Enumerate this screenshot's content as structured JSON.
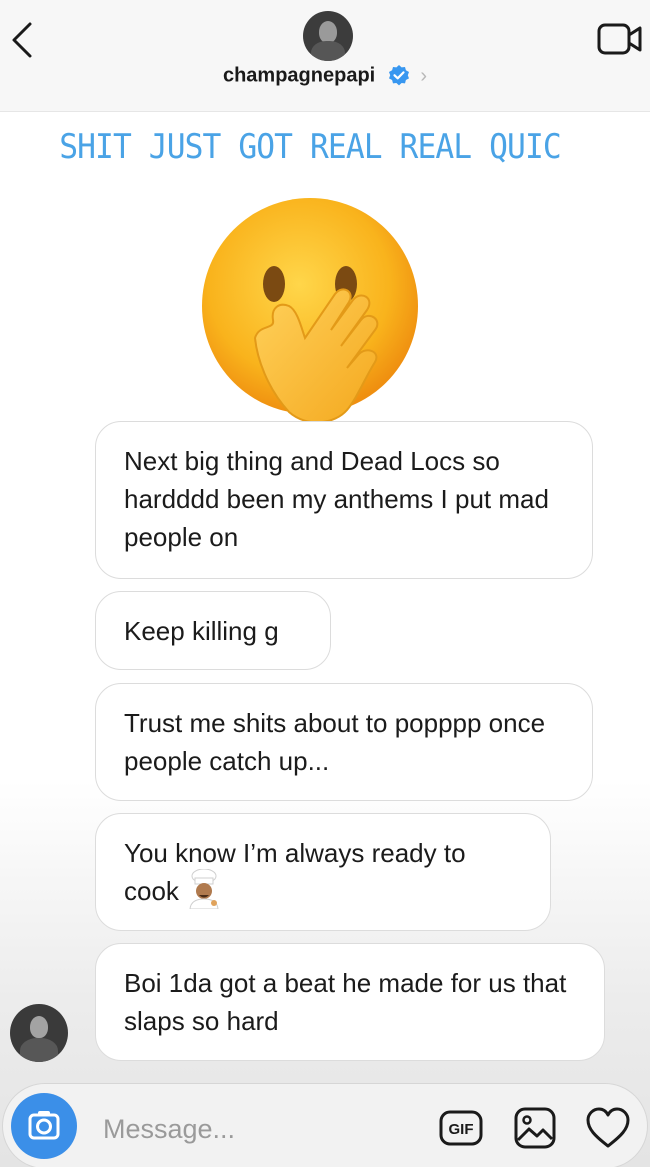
{
  "header": {
    "username": "champagnepapi",
    "verified": true,
    "chevron": "›"
  },
  "story": {
    "caption": "SHIT JUST GOT REAL REAL QUIC",
    "emoji": "face-with-hand-over-mouth"
  },
  "messages": [
    {
      "text": "Next big thing and Dead Locs so hardddd been my anthems I put mad people on"
    },
    {
      "text": "Keep killing g"
    },
    {
      "text": "Trust me shits about to popppp once people catch up..."
    },
    {
      "text": "You know I’m always ready to cook",
      "emoji": "cook-emoji"
    },
    {
      "text": "Boi 1da got a beat he made for us that slaps so hard"
    }
  ],
  "composer": {
    "placeholder": "Message...",
    "gif_label": "GIF"
  },
  "colors": {
    "caption": "#4aa3e6",
    "verified": "#3897f0",
    "camera_button": "#3b8fe8"
  }
}
